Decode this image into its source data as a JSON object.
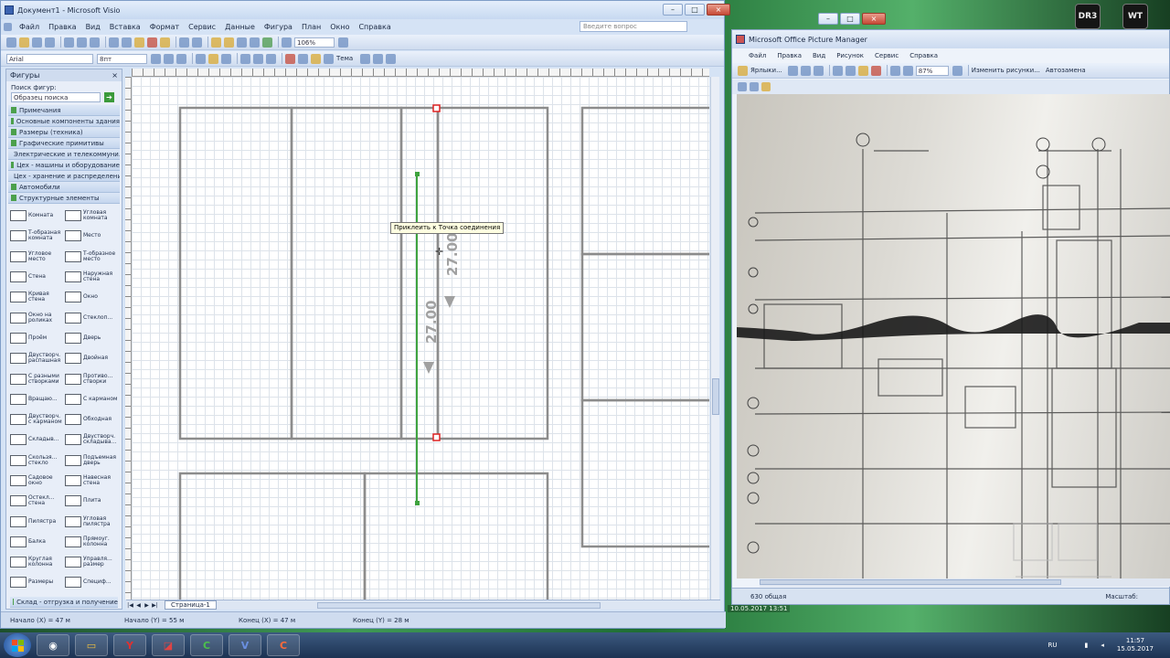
{
  "visio": {
    "title": "Документ1 - Microsoft Visio",
    "menu": [
      "Файл",
      "Правка",
      "Вид",
      "Вставка",
      "Формат",
      "Сервис",
      "Данные",
      "Фигура",
      "План",
      "Окно",
      "Справка"
    ],
    "help_placeholder": "Введите вопрос",
    "zoom": "106%",
    "font_name": "Arial",
    "font_size": "8пт",
    "theme_label": "Тема",
    "shapes_title": "Фигуры",
    "search_label": "Поиск фигур:",
    "search_placeholder": "Образец поиска",
    "stencils": [
      "Примечания",
      "Основные компоненты здания",
      "Размеры (техника)",
      "Графические примитивы",
      "Электрические и телекоммуни...",
      "Цех - машины и оборудование",
      "Цех - хранение и распределение",
      "Автомобили",
      "Структурные элементы"
    ],
    "shape_items": [
      "Комната",
      "Угловая комната",
      "Т-образная комната",
      "Место",
      "Угловое место",
      "Т-образное место",
      "Стена",
      "Наружная стена",
      "Кривая стена",
      "Окно",
      "Окно на роликах",
      "Стеклоп...",
      "Проём",
      "Дверь",
      "Двустворч. распашная",
      "Двойная",
      "С разными створками",
      "Противо... створки",
      "Вращаю...",
      "С карманом",
      "Двустворч. с карманом",
      "Обходная",
      "Складыв...",
      "Двустворч. складыва...",
      "Скользя... стекло",
      "Подъемная дверь",
      "Садовое окно",
      "Навесная стена",
      "Остекл... стена",
      "Плита",
      "Пилястра",
      "Угловая пилястра",
      "Балка",
      "Прямоуг. колонна",
      "Круглая колонна",
      "Управля... размер",
      "Размеры",
      "Специф..."
    ],
    "bottom_stencil": "Склад - отгрузка и получение",
    "page_tab": "Страница-1",
    "tooltip": "Приклеить к Точка соединения",
    "dimension_a": "27.00",
    "dimension_b": "27.00",
    "status": [
      "Начало (X) = 47 м",
      "Начало (Y) = 55 м",
      "Конец (X) = 47 м",
      "Конец (Y) = 28 м"
    ]
  },
  "picture_manager": {
    "title": "Microsoft Office Picture Manager",
    "menu": [
      "Файл",
      "Правка",
      "Вид",
      "Рисунок",
      "Сервис",
      "Справка"
    ],
    "shortcuts_label": "Ярлыки...",
    "zoom": "87%",
    "edit_label": "Изменить рисунки...",
    "auto_label": "Автозамена",
    "status_left": "630 общая",
    "status_zoom": "Масштаб:",
    "date": "10.05.2017 13:51"
  },
  "desktop": {
    "logo1": "DR3",
    "logo2": "WT"
  },
  "taskbar": {
    "lang": "RU",
    "time": "11:57",
    "date": "15.05.2017"
  }
}
